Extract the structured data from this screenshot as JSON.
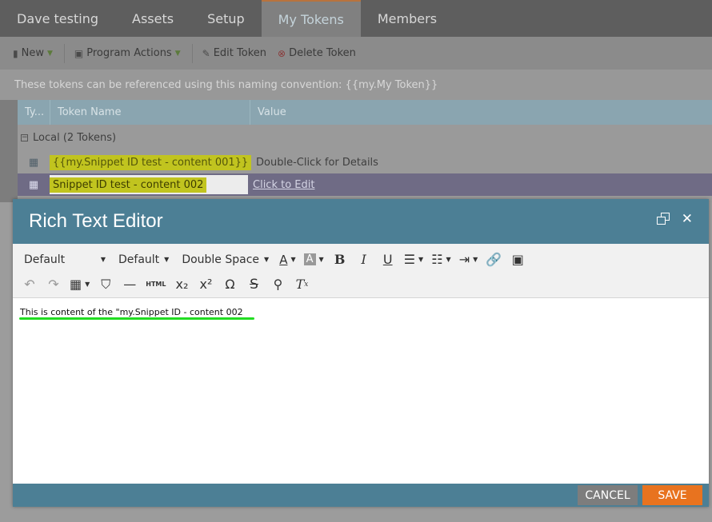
{
  "tabs": [
    "Dave testing",
    "Assets",
    "Setup",
    "My Tokens",
    "Members"
  ],
  "toolbar": {
    "new_label": "New",
    "program_actions_label": "Program Actions",
    "edit_token_label": "Edit Token",
    "delete_token_label": "Delete Token"
  },
  "info": "These tokens can be referenced using this naming convention: {{my.My Token}}",
  "grid": {
    "columns": [
      "Ty...",
      "Token Name",
      "Value"
    ],
    "group_label": "Local (2 Tokens)",
    "rows": [
      {
        "name": "{{my.Snippet ID test - content 001}}",
        "value": "Double-Click for Details"
      },
      {
        "name": "Snippet ID test - content 002",
        "value": "Click to Edit"
      }
    ]
  },
  "modal": {
    "title": "Rich Text Editor",
    "toolbar": {
      "font_family": "Default",
      "font_size": "Default",
      "line_spacing": "Double Space",
      "html_label": "HTML"
    },
    "content": "This is content of the \"my.Snippet ID - content 002",
    "cancel_label": "CANCEL",
    "save_label": "SAVE"
  },
  "colors": {
    "modal_header": "#4c7f95",
    "save_button": "#e8731f",
    "cancel_button": "#7d7d7d",
    "token_highlight": "#c1c41f",
    "annotation_underline": "#22dd22"
  },
  "icons": [
    "new-icon",
    "program-actions-icon",
    "edit-token-icon",
    "delete-token-icon",
    "restore-icon",
    "close-icon",
    "bold-icon",
    "italic-icon",
    "underline-icon",
    "link-icon",
    "image-icon",
    "undo-icon",
    "redo-icon",
    "table-icon",
    "bookmark-icon",
    "horizontal-rule-icon",
    "subscript-icon",
    "superscript-icon",
    "omega-icon",
    "strikethrough-icon",
    "find-icon",
    "clear-format-icon"
  ]
}
